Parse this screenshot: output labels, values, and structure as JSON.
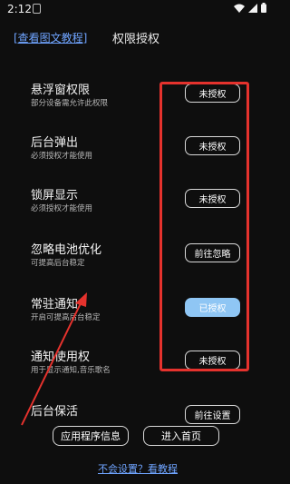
{
  "status_bar": {
    "time": "2:12",
    "icons": [
      "wifi-icon",
      "signal-icon",
      "battery-icon"
    ]
  },
  "header": {
    "help_link": "[查看图文教程]",
    "title": "权限授权"
  },
  "permissions": [
    {
      "title": "悬浮窗权限",
      "desc": "部分设备需允许此权限",
      "button": "未授权",
      "granted": false
    },
    {
      "title": "后台弹出",
      "desc": "必须授权才能使用",
      "button": "未授权",
      "granted": false
    },
    {
      "title": "锁屏显示",
      "desc": "必须授权才能使用",
      "button": "未授权",
      "granted": false
    },
    {
      "title": "忽略电池优化",
      "desc": "可提高后台稳定",
      "button": "前往忽略",
      "granted": false
    },
    {
      "title": "常驻通知",
      "desc": "开启可提高后台稳定",
      "button": "已授权",
      "granted": true
    },
    {
      "title": "通知使用权",
      "desc": "用于显示通知,音乐歌名",
      "button": "未授权",
      "granted": false
    },
    {
      "title": "后台保活",
      "desc": "",
      "button": "前往设置",
      "granted": false
    }
  ],
  "footer": {
    "app_info": "应用程序信息",
    "enter_home": "进入首页",
    "help": "不会设置？看教程"
  },
  "colors": {
    "background": "#0e0e0e",
    "link": "#6fa4ff",
    "granted_button": "#8fc6f4",
    "annotation": "#e5322d"
  }
}
